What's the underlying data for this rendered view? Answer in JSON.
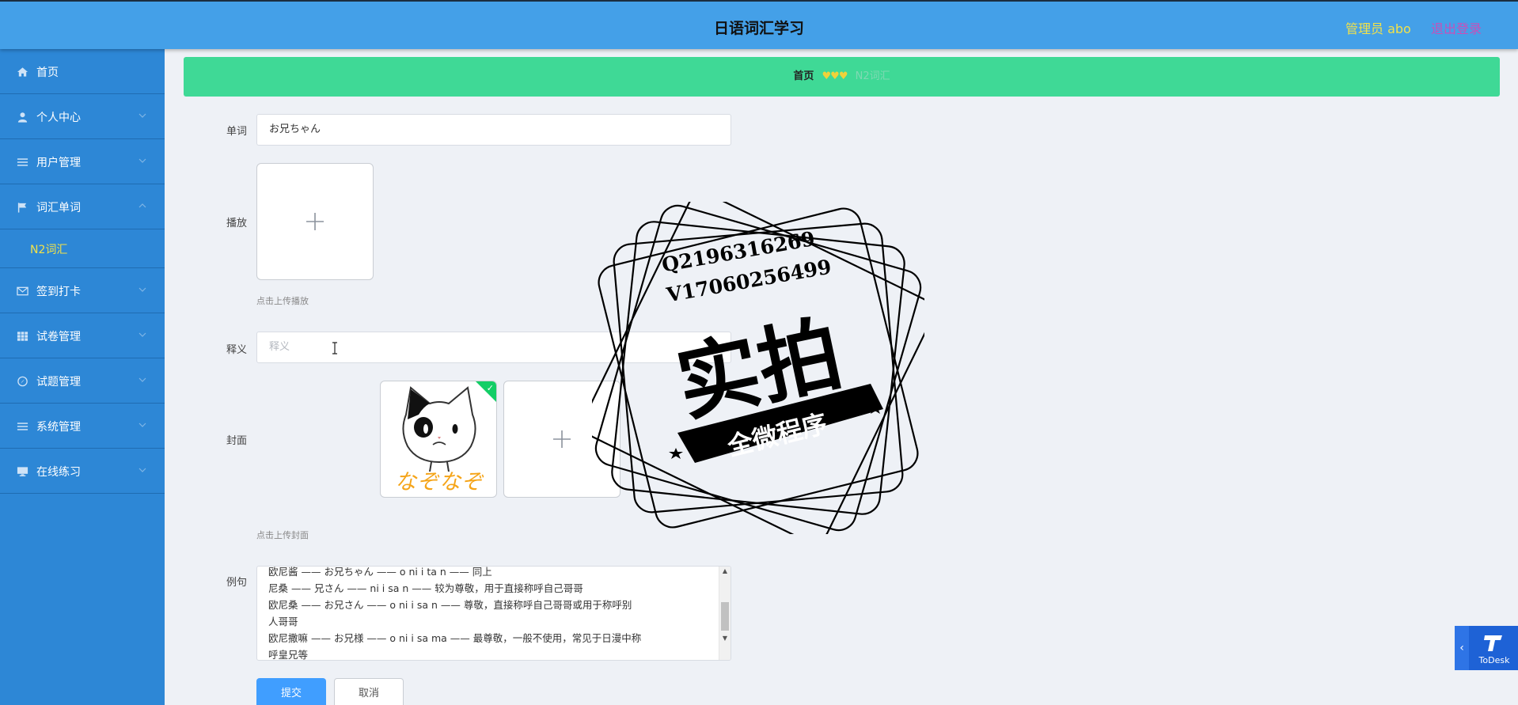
{
  "header": {
    "title": "日语词汇学习",
    "user": "管理员 abo",
    "logout": "退出登录"
  },
  "sidebar": {
    "items": [
      {
        "label": "首页",
        "icon": "home-icon"
      },
      {
        "label": "个人中心",
        "icon": "user-icon"
      },
      {
        "label": "用户管理",
        "icon": "list-icon"
      },
      {
        "label": "词汇单词",
        "icon": "flag-icon"
      },
      {
        "label": "签到打卡",
        "icon": "mail-icon"
      },
      {
        "label": "试卷管理",
        "icon": "grid-icon"
      },
      {
        "label": "试题管理",
        "icon": "compass-icon"
      },
      {
        "label": "系统管理",
        "icon": "list-icon"
      },
      {
        "label": "在线练习",
        "icon": "monitor-icon"
      }
    ],
    "sub_item": "N2词汇"
  },
  "breadcrumb": {
    "home": "首页",
    "separator": "♥♥♥",
    "current": "N2词汇"
  },
  "form": {
    "word_label": "单词",
    "word_value": "お兄ちゃん",
    "audio_label": "播放",
    "audio_hint": "点击上传播放",
    "meaning_label": "释义",
    "meaning_placeholder": "释义",
    "cover_label": "封面",
    "cover_hint": "点击上传封面",
    "cover_caption": "なぞなぞ",
    "example_label": "例句",
    "example_lines": [
      "欧尼酱 —— お兄ちゃん —— o ni i ta n —— 同上",
      "尼桑 —— 兄さん —— ni i sa n —— 较为尊敬，用于直接称呼自己哥哥",
      "欧尼桑 —— お兄さん —— o ni i sa n —— 尊敬，直接称呼自己哥哥或用于称呼别",
      "人哥哥",
      "欧尼撒嘛 —— お兄様 —— o ni i sa ma —— 最尊敬，一般不使用，常见于日漫中称",
      "呼皇兄等"
    ],
    "submit": "提交",
    "cancel": "取消"
  },
  "watermark": {
    "line1": "Q2196316269",
    "line2": "V17060256499",
    "big": "实拍",
    "banner": "全微程序"
  },
  "todesk": {
    "name": "ToDesk"
  },
  "colors": {
    "header": "#44a0e8",
    "sidebar": "#2d87d6",
    "breadcrumb": "#3fd996",
    "primary": "#409eff",
    "accent_yellow": "#f2e14a"
  }
}
